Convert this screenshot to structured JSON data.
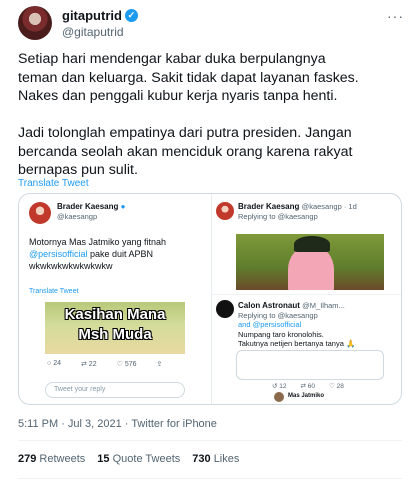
{
  "author": {
    "display_name": "gitaputrid",
    "handle": "@gitaputrid"
  },
  "more_label": "···",
  "tweet_text": "Setiap hari mendengar kabar duka berpulangnya\nteman dan keluarga. Sakit tidak dapat layanan faskes.\nNakes dan penggali kubur kerja nyaris tanpa henti.\n\nJadi tolonglah empatinya dari putra presiden. Jangan\nbercanda seolah akan menciduk orang karena rakyat\nbernapas pun sulit.",
  "translate_label": "Translate Tweet",
  "screenshot_left": {
    "name": "Brader Kaesang",
    "handle": "@kaesangp",
    "text_line1": "Motornya Mas Jatmiko yang fitnah",
    "mention": "@persisofficial",
    "text_after_mention": " pake duit APBN",
    "text_line3": "wkwkwkwkwkwkwkw",
    "translate_label": "Translate Tweet",
    "meme_caption_line1": "Kasihan Mana",
    "meme_caption_line2": "Msh Muda",
    "stats": [
      "24",
      "22",
      "576"
    ],
    "reply_placeholder": "Tweet your reply"
  },
  "screenshot_right": {
    "name": "Brader Kaesang",
    "handle": "@kaesangp · 1d",
    "replying_to": "Replying to @kaesangp",
    "reply2_name": "Calon Astronaut",
    "reply2_handle": "@M_Ilham...",
    "reply2_replying": "Replying to @kaesangp",
    "reply2_replying_2": "and @persisofficial",
    "reply2_text_1": "Numpang taro kronolohis.",
    "reply2_text_2": "Takutnya netijen bertanya tanya 🙏",
    "reply2_stats": [
      "12",
      "60",
      "28"
    ],
    "reply3_name": "Mas Jatmiko"
  },
  "timestamp": "5:11 PM · Jul 3, 2021 · Twitter for iPhone",
  "stats": {
    "retweets_count": "279",
    "retweets_label": "Retweets",
    "quotes_count": "15",
    "quotes_label": "Quote Tweets",
    "likes_count": "730",
    "likes_label": "Likes"
  },
  "colors": {
    "accent": "#1d9bf0",
    "secondary_text": "#536471"
  }
}
